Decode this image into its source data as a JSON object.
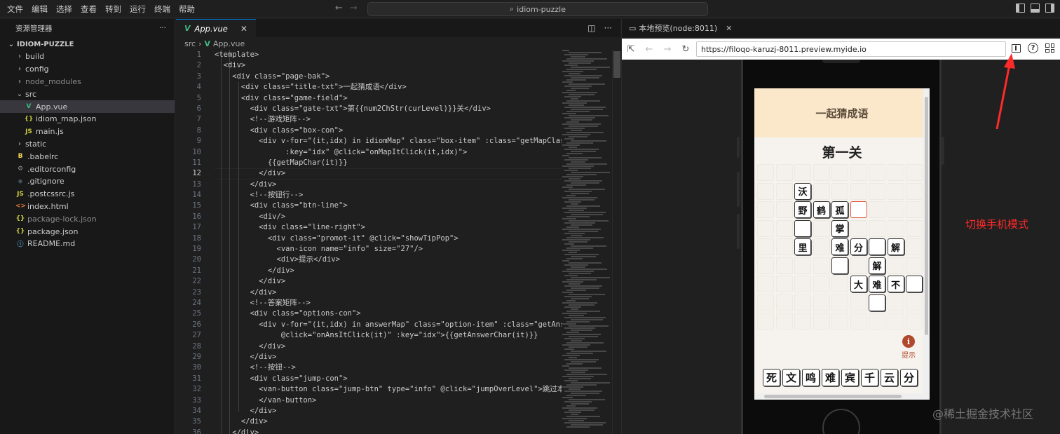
{
  "menu": [
    "文件",
    "编辑",
    "选择",
    "查看",
    "转到",
    "运行",
    "终端",
    "帮助"
  ],
  "command_center": {
    "text": "idiom-puzzle"
  },
  "explorer": {
    "title": "资源管理器",
    "more": "···",
    "root": "IDIOM-PUZZLE",
    "items": [
      {
        "label": "build",
        "type": "folder"
      },
      {
        "label": "config",
        "type": "folder"
      },
      {
        "label": "node_modules",
        "type": "folder",
        "dim": true
      },
      {
        "label": "src",
        "type": "folder-open"
      },
      {
        "label": "App.vue",
        "type": "vue",
        "selected": true
      },
      {
        "label": "idiom_map.json",
        "type": "json"
      },
      {
        "label": "main.js",
        "type": "js"
      },
      {
        "label": "static",
        "type": "folder"
      },
      {
        "label": ".babelrc",
        "type": "babel"
      },
      {
        "label": ".editorconfig",
        "type": "gear"
      },
      {
        "label": ".gitignore",
        "type": "git"
      },
      {
        "label": ".postcssrc.js",
        "type": "js"
      },
      {
        "label": "index.html",
        "type": "html"
      },
      {
        "label": "package-lock.json",
        "type": "json",
        "dim": true
      },
      {
        "label": "package.json",
        "type": "json"
      },
      {
        "label": "README.md",
        "type": "info"
      }
    ]
  },
  "editor": {
    "tab": "App.vue",
    "tab_close": "✕",
    "breadcrumb": {
      "folder": "src",
      "sep": "›",
      "file": "App.vue"
    },
    "active_line": 12,
    "lines": [
      "<template>",
      "  <div>",
      "    <div class=\"page-bak\">",
      "      <div class=\"title-txt\">一起猜成语</div>",
      "      <div class=\"game-field\">",
      "        <div class=\"gate-txt\">第{{num2ChStr(curLevel)}}关</div>",
      "        <!--游戏矩阵-->",
      "        <div class=\"box-con\">",
      "          <div v-for=\"(it,idx) in idiomMap\" class=\"box-item\" :class=\"getMapClass",
      "                :key=\"idx\" @click=\"onMapItClick(it,idx)\">",
      "            {{getMapChar(it)}}",
      "          </div>",
      "        </div>",
      "        <!--按钮行-->",
      "        <div class=\"btn-line\">",
      "          <div/>",
      "          <div class=\"line-right\">",
      "            <div class=\"promot-it\" @click=\"showTipPop\">",
      "              <van-icon name=\"info\" size=\"27\"/>",
      "              <div>提示</div>",
      "            </div>",
      "          </div>",
      "        </div>",
      "        <!--答案矩阵-->",
      "        <div class=\"options-con\">",
      "          <div v-for=\"(it,idx) in answerMap\" class=\"option-item\" :class=\"getAnsC",
      "               @click=\"onAnsItClick(it)\" :key=\"idx\">{{getAnswerChar(it)}}",
      "          </div>",
      "        </div>",
      "        <!--按钮-->",
      "        <div class=\"jump-con\">",
      "          <van-button class=\"jump-btn\" type=\"info\" @click=\"jumpOverLevel\">跳过本关",
      "          </van-button>",
      "        </div>",
      "      </div>",
      "    </div>"
    ]
  },
  "preview": {
    "tab_title": "本地预览(node:8011)",
    "tab_close": "✕",
    "url": "https://filoqo-karuzj-8011.preview.myide.io",
    "help_icon": "?",
    "game": {
      "title": "一起猜成语",
      "gate": "第一关",
      "tip_label": "提示",
      "tip_icon": "i",
      "tiles": [
        {
          "ch": "沃",
          "col": 2,
          "row": 1
        },
        {
          "ch": "野",
          "col": 2,
          "row": 2
        },
        {
          "ch": "鹤",
          "col": 3,
          "row": 2
        },
        {
          "ch": "孤",
          "col": 4,
          "row": 2
        },
        {
          "ch": "",
          "col": 5,
          "row": 2,
          "selected": true
        },
        {
          "ch": "",
          "col": 2,
          "row": 3
        },
        {
          "ch": "掌",
          "col": 4,
          "row": 3
        },
        {
          "ch": "里",
          "col": 2,
          "row": 4
        },
        {
          "ch": "难",
          "col": 4,
          "row": 4
        },
        {
          "ch": "分",
          "col": 5,
          "row": 4
        },
        {
          "ch": "",
          "col": 6,
          "row": 4
        },
        {
          "ch": "解",
          "col": 7,
          "row": 4
        },
        {
          "ch": "",
          "col": 4,
          "row": 5
        },
        {
          "ch": "解",
          "col": 6,
          "row": 5
        },
        {
          "ch": "大",
          "col": 5,
          "row": 6
        },
        {
          "ch": "难",
          "col": 6,
          "row": 6
        },
        {
          "ch": "不",
          "col": 7,
          "row": 6
        },
        {
          "ch": "",
          "col": 8,
          "row": 6
        },
        {
          "ch": "",
          "col": 6,
          "row": 7
        }
      ],
      "answers": [
        "死",
        "文",
        "鸣",
        "难",
        "宾",
        "千",
        "云",
        "分"
      ]
    }
  },
  "annotation": {
    "text": "切换手机模式",
    "color": "#ff2a2a"
  },
  "watermark": "@稀土掘金技术社区"
}
